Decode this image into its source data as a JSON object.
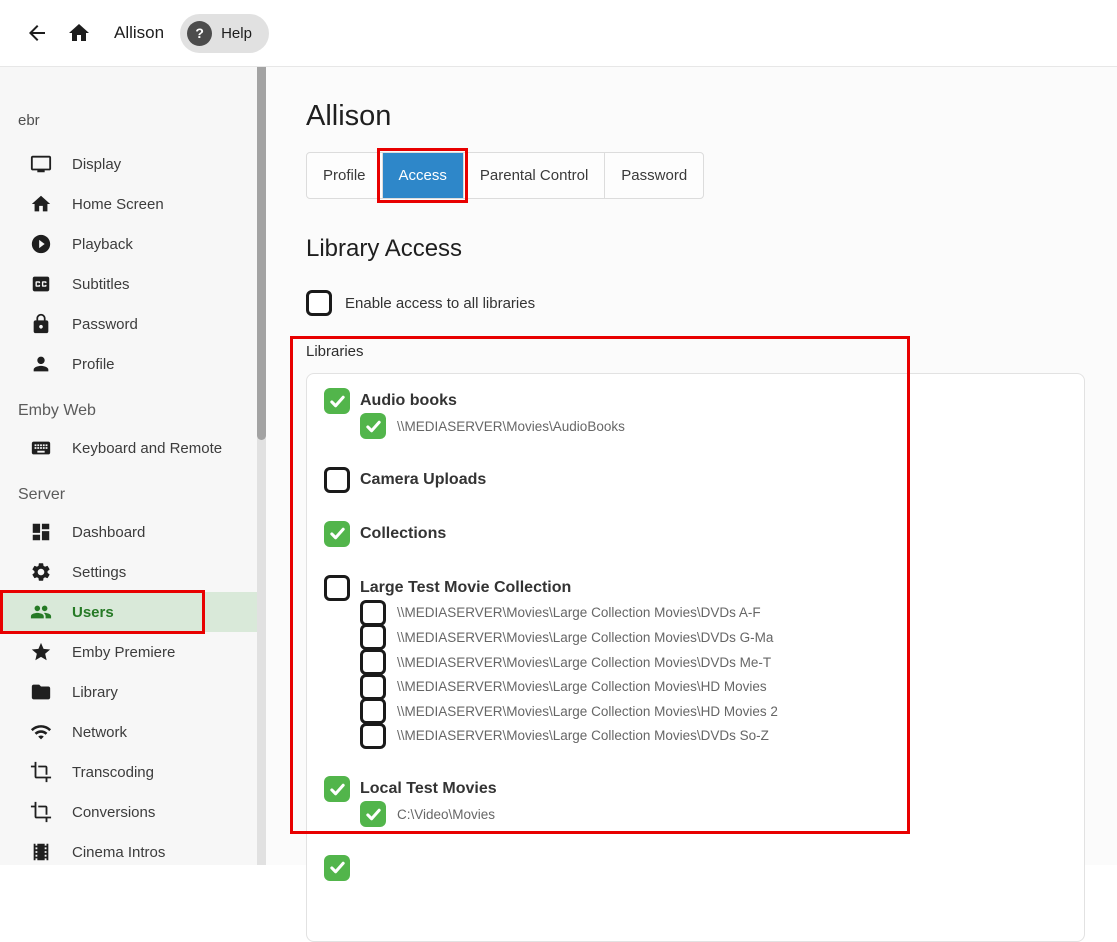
{
  "colors": {
    "accent_green": "#52b54b",
    "tab_blue": "#2e87c9",
    "annotation_red": "#e80000",
    "active_item_bg": "#d9e9d9",
    "active_item_fg": "#267a26"
  },
  "topbar": {
    "back_icon": "back-arrow-icon",
    "home_icon": "home-icon",
    "title": "Allison",
    "help": {
      "label": "Help",
      "icon": "question-mark-icon"
    }
  },
  "sidebar": {
    "user_section_label": "ebr",
    "user_items": [
      {
        "label": "Display",
        "icon": "monitor-icon"
      },
      {
        "label": "Home Screen",
        "icon": "home-icon"
      },
      {
        "label": "Playback",
        "icon": "play-circle-icon"
      },
      {
        "label": "Subtitles",
        "icon": "closed-caption-icon"
      },
      {
        "label": "Password",
        "icon": "lock-icon"
      },
      {
        "label": "Profile",
        "icon": "person-icon"
      }
    ],
    "sections": [
      {
        "label": "Emby Web",
        "items": [
          {
            "label": "Keyboard and Remote",
            "icon": "keyboard-icon"
          }
        ]
      },
      {
        "label": "Server",
        "items": [
          {
            "label": "Dashboard",
            "icon": "dashboard-icon"
          },
          {
            "label": "Settings",
            "icon": "gear-icon"
          },
          {
            "label": "Users",
            "icon": "people-icon",
            "active": true,
            "annotated": true
          },
          {
            "label": "Emby Premiere",
            "icon": "star-icon"
          },
          {
            "label": "Library",
            "icon": "folder-icon"
          },
          {
            "label": "Network",
            "icon": "wifi-icon"
          },
          {
            "label": "Transcoding",
            "icon": "crop-icon"
          },
          {
            "label": "Conversions",
            "icon": "crop-icon"
          },
          {
            "label": "Cinema Intros",
            "icon": "film-icon"
          }
        ]
      }
    ]
  },
  "main": {
    "title": "Allison",
    "tabs": [
      {
        "label": "Profile"
      },
      {
        "label": "Access",
        "active": true,
        "annotated": true
      },
      {
        "label": "Parental Control"
      },
      {
        "label": "Password"
      }
    ],
    "section_title": "Library Access",
    "enable_all": {
      "label": "Enable access to all libraries",
      "checked": false
    },
    "libraries_label": "Libraries",
    "libraries": [
      {
        "name": "Audio books",
        "checked": true,
        "paths": [
          {
            "path": "\\\\MEDIASERVER\\Movies\\AudioBooks",
            "checked": true
          }
        ]
      },
      {
        "name": "Camera Uploads",
        "checked": false,
        "paths": []
      },
      {
        "name": "Collections",
        "checked": true,
        "paths": []
      },
      {
        "name": "Large Test Movie Collection",
        "checked": false,
        "paths": [
          {
            "path": "\\\\MEDIASERVER\\Movies\\Large Collection Movies\\DVDs A-F",
            "checked": false
          },
          {
            "path": "\\\\MEDIASERVER\\Movies\\Large Collection Movies\\DVDs G-Ma",
            "checked": false
          },
          {
            "path": "\\\\MEDIASERVER\\Movies\\Large Collection Movies\\DVDs Me-T",
            "checked": false
          },
          {
            "path": "\\\\MEDIASERVER\\Movies\\Large Collection Movies\\HD Movies",
            "checked": false
          },
          {
            "path": "\\\\MEDIASERVER\\Movies\\Large Collection Movies\\HD Movies 2",
            "checked": false
          },
          {
            "path": "\\\\MEDIASERVER\\Movies\\Large Collection Movies\\DVDs So-Z",
            "checked": false
          }
        ]
      },
      {
        "name": "Local Test Movies",
        "checked": true,
        "paths": [
          {
            "path": "C:\\Video\\Movies",
            "checked": true
          }
        ]
      },
      {
        "name": "",
        "checked": true,
        "partial": true,
        "paths": []
      }
    ]
  }
}
